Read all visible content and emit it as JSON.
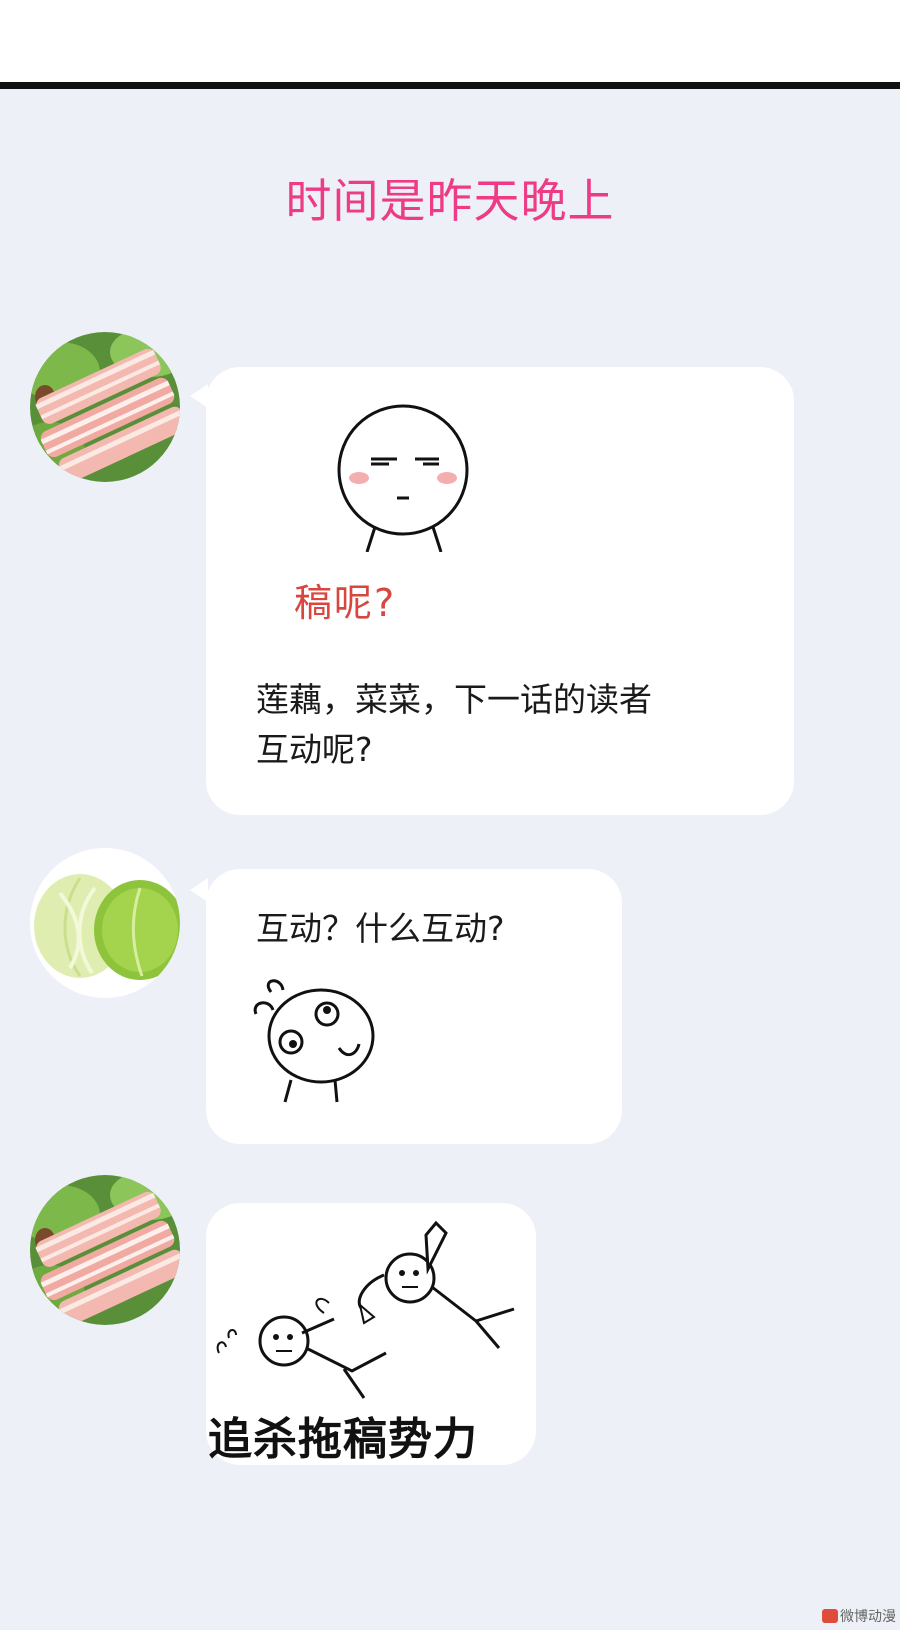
{
  "header": {
    "time_label": "时间是昨天晚上"
  },
  "messages": [
    {
      "sender": "pork-avatar",
      "sticker_caption": "稿呢?",
      "text_line1": "莲藕，菜菜，下一话的读者",
      "text_line2": "互动呢?"
    },
    {
      "sender": "cabbage-avatar",
      "text": "互动？什么互动?"
    },
    {
      "sender": "pork-avatar",
      "sticker_caption": "追杀拖稿势力"
    }
  ],
  "watermark": {
    "text": "微博动漫"
  },
  "colors": {
    "title": "#ef3a86",
    "chat_background": "#edf0f7",
    "bubble": "#ffffff",
    "sticker_red_text": "#d8473f"
  }
}
